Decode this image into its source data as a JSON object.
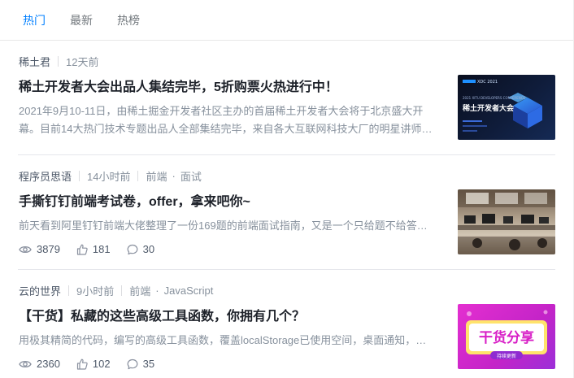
{
  "tabs": [
    "热门",
    "最新",
    "热榜"
  ],
  "entries": [
    {
      "author": "稀土君",
      "time": "12天前",
      "title": "稀土开发者大会出品人集结完毕，5折购票火热进行中！",
      "abstract": "2021年9月10-11日，由稀土掘金开发者社区主办的首届稀土开发者大会将于北京盛大开幕。目前14大热门技术专题出品人全部集结完毕，来自各大互联网科技大厂的明星讲师…",
      "thumb": {
        "top_label": "2021 XITU DEVELOPERS CONFERENCE",
        "title": "稀土开发者大会",
        "logo": "XDC 2021"
      }
    },
    {
      "author": "程序员思语",
      "time": "14小时前",
      "tags": [
        "前端",
        "面试"
      ],
      "title": "手撕钉钉前端考试卷，offer，拿来吧你~",
      "abstract": "前天看到阿里钉钉前端大佬整理了一份169题的前端面试指南，又是一个只给题不给答案…",
      "views": "3879",
      "likes": "181",
      "comments": "30"
    },
    {
      "author": "云的世界",
      "time": "9小时前",
      "tags": [
        "前端",
        "JavaScript"
      ],
      "title": "【干货】私藏的这些高级工具函数，你拥有几个？",
      "abstract": "用极其精简的代码，编写的高级工具函数，覆盖localStorage已使用空间，桌面通知，…",
      "views": "2360",
      "likes": "102",
      "comments": "35",
      "thumb": {
        "title": "干货分享",
        "sub": "持续更新"
      }
    }
  ],
  "colors": {
    "accent": "#007fff",
    "title": "#1d2129",
    "muted": "#86909c"
  }
}
